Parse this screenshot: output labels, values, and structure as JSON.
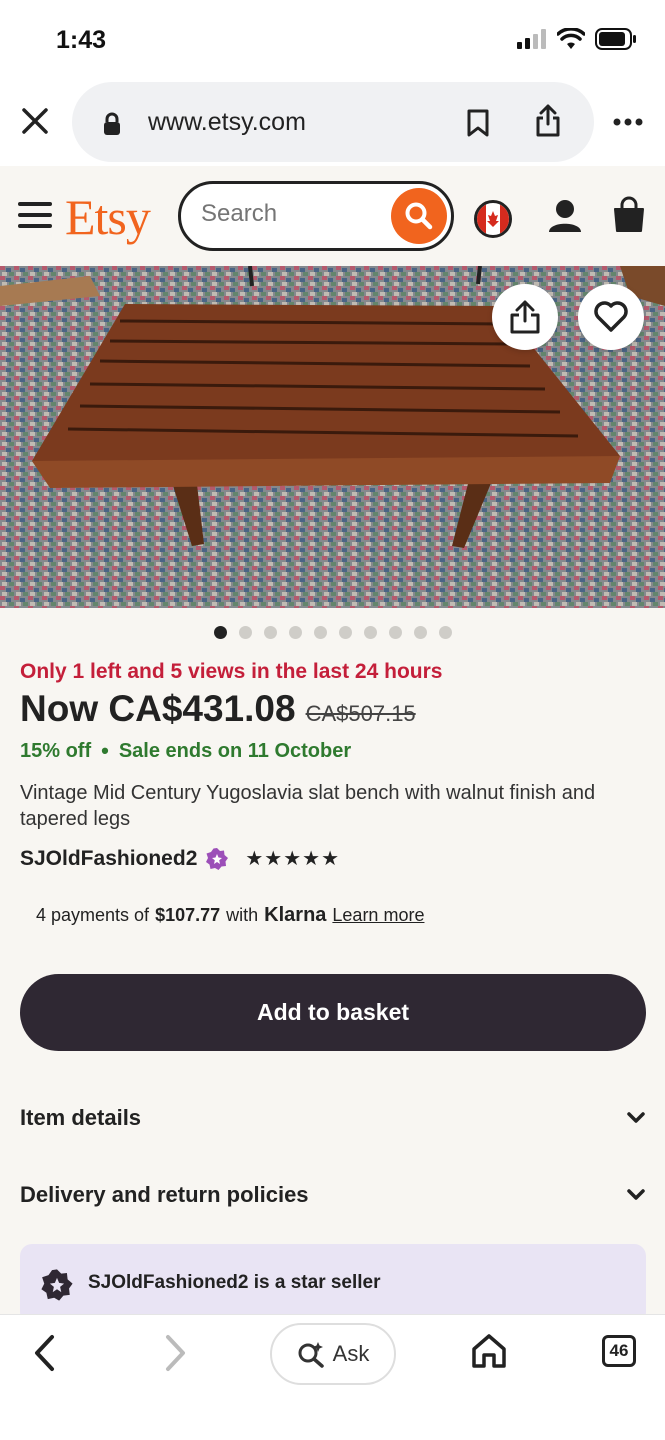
{
  "status_bar": {
    "time": "1:43"
  },
  "browser": {
    "url": "www.etsy.com",
    "tab_count": "46",
    "ask_label": "Ask"
  },
  "header": {
    "logo": "Etsy",
    "search_placeholder": "Search"
  },
  "gallery": {
    "image_count": 10,
    "active_index": 0
  },
  "product": {
    "scarcity": "Only 1 left and 5 views in the last 24 hours",
    "price_now": "Now CA$431.08",
    "price_original": "CA$507.15",
    "discount": "15% off",
    "sale_ends": "Sale ends on 11 October",
    "title": "Vintage Mid Century Yugoslavia slat bench with walnut finish and tapered legs",
    "shop_name": "SJOldFashioned2",
    "stars": "★★★★★",
    "rating": 5
  },
  "klarna": {
    "prefix": "4 payments of",
    "amount": "$107.77",
    "with": "with",
    "brand": "Klarna",
    "learn_more": "Learn more"
  },
  "actions": {
    "add_to_basket": "Add to basket"
  },
  "accordions": [
    {
      "label": "Item details"
    },
    {
      "label": "Delivery and return policies"
    }
  ],
  "star_seller": {
    "text": "SJOldFashioned2 is a star seller"
  },
  "colors": {
    "etsy_orange": "#f1641e",
    "scarcity_red": "#c41f3a",
    "sale_green": "#2f7a2f",
    "button_dark": "#2f2833",
    "star_seller_bg": "#e9e4f4",
    "star_seller_badge": "#9c4fb8"
  }
}
